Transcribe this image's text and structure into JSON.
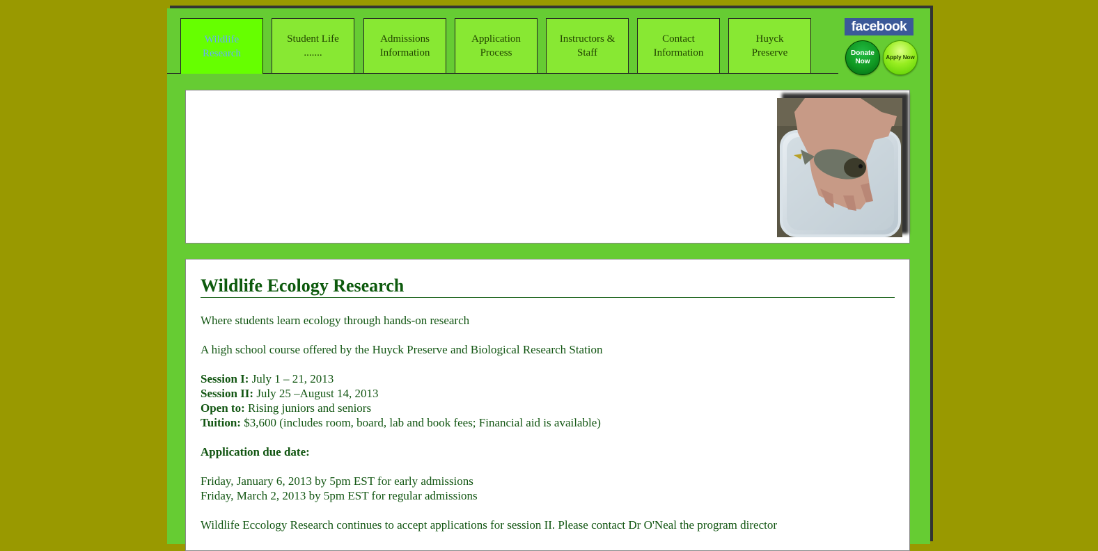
{
  "nav": {
    "tabs": [
      {
        "label_line1": "Wildlife",
        "label_line2": "Research",
        "active": true
      },
      {
        "label_line1": "Student Life",
        "label_line2": ".......",
        "active": false
      },
      {
        "label_line1": "Admissions",
        "label_line2": "Information",
        "active": false
      },
      {
        "label_line1": "Application",
        "label_line2": "Process",
        "active": false
      },
      {
        "label_line1": "Instructors &",
        "label_line2": "Staff",
        "active": false
      },
      {
        "label_line1": "Contact",
        "label_line2": "Information",
        "active": false
      },
      {
        "label_line1": "Huyck",
        "label_line2": "Preserve",
        "active": false
      }
    ]
  },
  "social": {
    "facebook_label": "facebook",
    "donate_line1": "Donate",
    "donate_line2": "Now",
    "apply_label": "Apply Now"
  },
  "content": {
    "title": "Wildlife Ecology Research",
    "tagline": "Where students learn ecology through hands-on research",
    "offered_by": "A high school course offered by the Huyck Preserve and Biological Research Station",
    "session1_label": "Session I:",
    "session1_value": " July 1 – 21, 2013",
    "session2_label": "Session II:",
    "session2_value": " July 25 –August 14, 2013",
    "open_label": "Open to:",
    "open_value": " Rising juniors and seniors",
    "tuition_label": "Tuition:",
    "tuition_value": " $3,600 (includes room, board, lab and book fees; Financial aid is available)",
    "due_label": "Application due date:",
    "due_early": "Friday, January 6, 2013 by 5pm EST for early admissions",
    "due_regular": "Friday, March 2, 2013 by 5pm EST for regular admissions",
    "note": "Wildlife Eccology Research continues to accept applications for session II. Please contact Dr O'Neal the program director"
  },
  "colors": {
    "page_bg": "#999900",
    "frame_bg": "#66cc33",
    "tab_bg": "#88e833",
    "tab_active_bg": "#66ff00",
    "text_green": "#115511"
  }
}
